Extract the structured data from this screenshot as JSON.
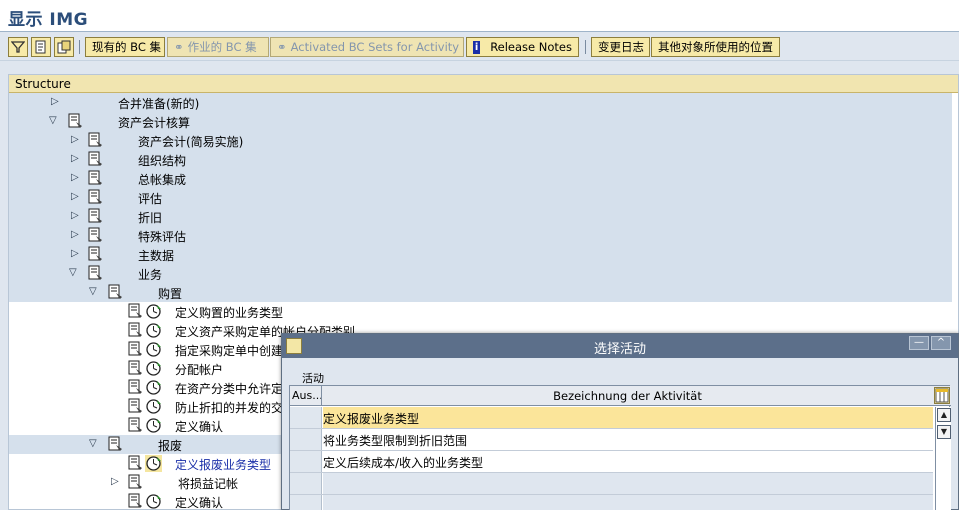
{
  "window": {
    "title": "显示 IMG"
  },
  "toolbar": {
    "buttons": [
      {
        "label": "现有的 BC 集",
        "enabled": true
      },
      {
        "label": "作业的 BC 集",
        "enabled": false
      },
      {
        "label": "Activated BC Sets for Activity",
        "enabled": false
      },
      {
        "label": "Release Notes",
        "enabled": true
      },
      {
        "label": "变更日志",
        "enabled": true
      },
      {
        "label": "其他对象所使用的位置",
        "enabled": true
      }
    ]
  },
  "structure": {
    "header": "Structure",
    "items": [
      {
        "label": "合并准备(新的)"
      },
      {
        "label": "资产会计核算"
      },
      {
        "label": "资产会计(简易实施)"
      },
      {
        "label": "组织结构"
      },
      {
        "label": "总帐集成"
      },
      {
        "label": "评估"
      },
      {
        "label": "折旧"
      },
      {
        "label": "特殊评估"
      },
      {
        "label": "主数据"
      },
      {
        "label": "业务"
      },
      {
        "label": "购置"
      },
      {
        "label": "定义购置的业务类型"
      },
      {
        "label": "定义资产采购定单的帐户分配类别"
      },
      {
        "label": "指定采购定单中创建"
      },
      {
        "label": "分配帐户"
      },
      {
        "label": "在资产分类中允许定"
      },
      {
        "label": "防止折扣的并发的交"
      },
      {
        "label": "定义确认"
      },
      {
        "label": "报废"
      },
      {
        "label": "定义报废业务类型"
      },
      {
        "label": "将损益记帐"
      },
      {
        "label": "定义确认"
      }
    ]
  },
  "dialog": {
    "title": "选择活动",
    "group_label": "活动",
    "columns": {
      "aus": "Aus...",
      "bez": "Bezeichnung der Aktivität"
    },
    "rows": [
      {
        "bez": "定义报废业务类型"
      },
      {
        "bez": "将业务类型限制到折旧范围"
      },
      {
        "bez": "定义后续成本/收入的业务类型"
      },
      {
        "bez": ""
      },
      {
        "bez": ""
      }
    ]
  }
}
